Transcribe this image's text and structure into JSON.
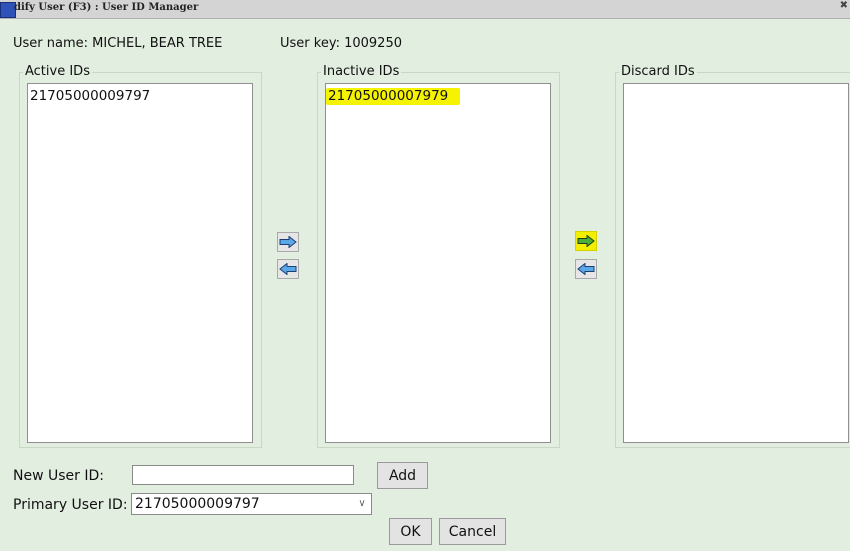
{
  "window": {
    "title": "dify User (F3) : User ID Manager",
    "close_glyph": "✖"
  },
  "info": {
    "user_name": "User name: MICHEL, BEAR TREE",
    "user_key": "User key: 1009250"
  },
  "active": {
    "label": "Active IDs",
    "items": [
      "21705000009797"
    ]
  },
  "inactive": {
    "label": "Inactive IDs",
    "items": [
      "21705000007979"
    ],
    "highlight_color": "#f6f300"
  },
  "discard": {
    "label": "Discard IDs",
    "items": []
  },
  "icons": {
    "move_right": "arrow-right-icon",
    "move_left": "arrow-left-icon",
    "arrow_fill": "#5aa8e8",
    "arrow_fill_highlighted": "#4cae3a"
  },
  "form": {
    "new_id_label": "New User ID:",
    "new_id_value": "",
    "add_label": "Add",
    "primary_label": "Primary User ID:",
    "primary_value": "21705000009797",
    "ok_label": "OK",
    "cancel_label": "Cancel"
  }
}
